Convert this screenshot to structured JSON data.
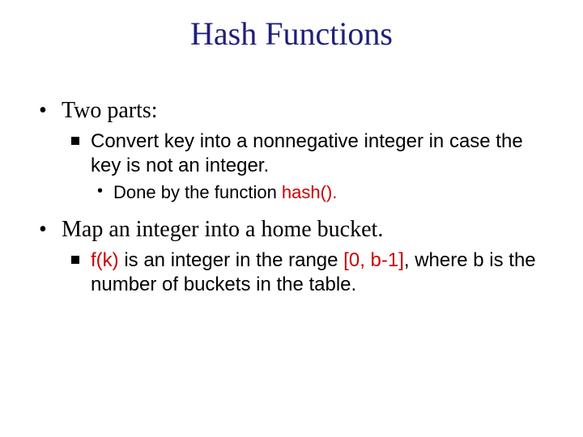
{
  "title": "Hash Functions",
  "bullets": {
    "p1": "Two parts:",
    "p1a_pre": "Convert key into a nonnegative integer in case the key is not an integer.",
    "p1a1_pre": "Done by the function ",
    "p1a1_red": "hash().",
    "p2": "Map an integer into a home bucket.",
    "p2a_1": "f(k)",
    "p2a_2": " is an integer in the range ",
    "p2a_3": "[0, b-1]",
    "p2a_4": ", where b is the number of buckets in the table."
  }
}
